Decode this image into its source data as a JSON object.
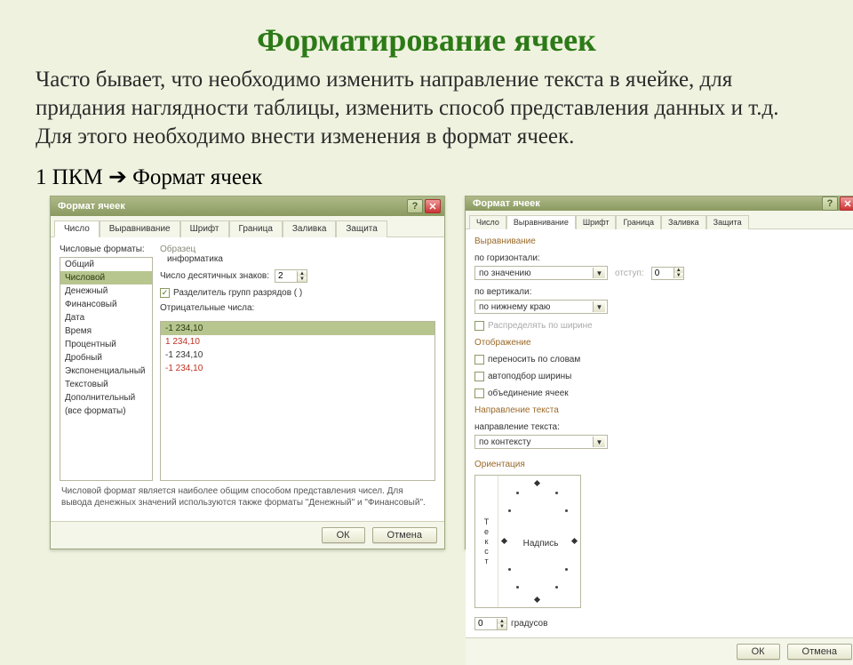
{
  "title": "Форматирование ячеек",
  "paragraph": "Часто бывает, что необходимо изменить направление текста в ячейке, для придания наглядности таблицы, изменить способ представления данных и т.д. Для этого необходимо внести изменения в формат ячеек.",
  "instruction": "1 ПКМ ➔ Формат ячеек",
  "dialog": {
    "title": "Формат ячеек",
    "help": "?",
    "close": "✕",
    "tabs": [
      "Число",
      "Выравнивание",
      "Шрифт",
      "Граница",
      "Заливка",
      "Защита"
    ],
    "ok": "ОК",
    "cancel": "Отмена"
  },
  "number_tab": {
    "formats_label": "Числовые форматы:",
    "formats": [
      "Общий",
      "Числовой",
      "Денежный",
      "Финансовый",
      "Дата",
      "Время",
      "Процентный",
      "Дробный",
      "Экспоненциальный",
      "Текстовый",
      "Дополнительный",
      "(все форматы)"
    ],
    "selected_index": 1,
    "sample_heading": "Образец",
    "sample_value": "информатика",
    "decimals_label": "Число десятичных знаков:",
    "decimals_value": "2",
    "thousands_label": "Разделитель групп разрядов ( )",
    "negative_label": "Отрицательные числа:",
    "negatives": [
      "-1 234,10",
      "1 234,10",
      "-1 234,10",
      "-1 234,10"
    ],
    "description": "Числовой формат является наиболее общим способом представления чисел. Для вывода денежных значений используются также форматы \"Денежный\" и \"Финансовый\"."
  },
  "align_tab": {
    "alignment_heading": "Выравнивание",
    "h_label": "по горизонтали:",
    "h_value": "по значению",
    "indent_label": "отступ:",
    "indent_value": "0",
    "v_label": "по вертикали:",
    "v_value": "по нижнему краю",
    "distribute_label": "Распределять по ширине",
    "display_heading": "Отображение",
    "wrap_label": "переносить по словам",
    "autofit_label": "автоподбор ширины",
    "merge_label": "объединение ячеек",
    "direction_heading": "Направление текста",
    "text_dir_label": "направление текста:",
    "text_dir_value": "по контексту",
    "orient_heading": "Ориентация",
    "orient_vertical_label": "Текст",
    "orient_nadpis": "Надпись",
    "deg_value": "0",
    "deg_label": "градусов"
  }
}
